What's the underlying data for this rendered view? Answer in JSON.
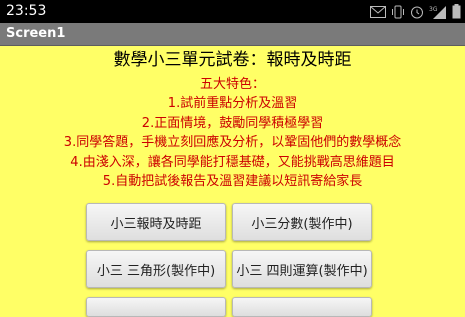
{
  "status_bar": {
    "time": "23:53",
    "icons": [
      "mail-icon",
      "vibrate-icon",
      "alarm-icon",
      "signal-3g-icon",
      "battery-icon"
    ]
  },
  "screen": {
    "title": "Screen1"
  },
  "main": {
    "heading": "數學小三單元試卷：報時及時距",
    "features_title": "五大特色：",
    "features": [
      "1.試前重點分析及溫習",
      "2.正面情境，鼓勵同學積極學習",
      "3.同學答題，手機立刻回應及分析，以鞏固他們的數學概念",
      "4.由淺入深，讓各同學能打穩基礎，又能挑戰高思維題目",
      "5.自動把試後報告及溫習建議以短訊寄給家長"
    ],
    "buttons": [
      {
        "label": "小三報時及時距"
      },
      {
        "label": "小三分數(製作中)"
      },
      {
        "label": "小三 三角形(製作中)"
      },
      {
        "label": "小三 四則運算(製作中)"
      },
      {
        "label": ""
      },
      {
        "label": ""
      }
    ]
  },
  "colors": {
    "background": "#FFFF66",
    "feature_text": "#CC0000",
    "title_bar": "#7a7a7a"
  }
}
